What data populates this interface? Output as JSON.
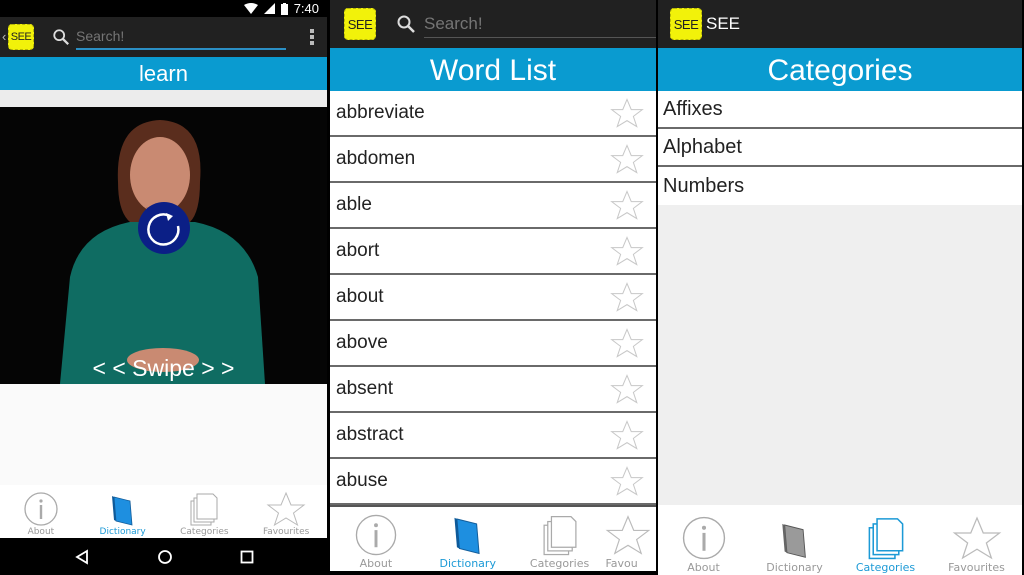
{
  "status_bar": {
    "time": "7:40"
  },
  "panel_learn": {
    "app_logo_text": "SEE",
    "search_placeholder": "Search!",
    "title": "learn",
    "swipe_hint": "< < Swipe > >",
    "tabs": [
      {
        "label": "About",
        "icon": "info-icon",
        "active": false
      },
      {
        "label": "Dictionary",
        "icon": "book-icon",
        "active": true
      },
      {
        "label": "Categories",
        "icon": "pages-icon",
        "active": false
      },
      {
        "label": "Favourites",
        "icon": "star-icon",
        "active": false
      }
    ]
  },
  "panel_wordlist": {
    "app_logo_text": "SEE",
    "search_placeholder": "Search!",
    "title": "Word List",
    "words": [
      "abbreviate",
      "abdomen",
      "able",
      "abort",
      "about",
      "above",
      "absent",
      "abstract",
      "abuse"
    ],
    "tabs": [
      {
        "label": "About",
        "icon": "info-icon",
        "active": false
      },
      {
        "label": "Dictionary",
        "icon": "book-icon",
        "active": true
      },
      {
        "label": "Categories",
        "icon": "pages-icon",
        "active": false
      },
      {
        "label": "Favou",
        "icon": "star-icon",
        "active": false
      }
    ]
  },
  "panel_categories": {
    "app_logo_text": "SEE",
    "app_name": "SEE",
    "title": "Categories",
    "categories": [
      "Affixes",
      "Alphabet",
      "Numbers"
    ],
    "tabs": [
      {
        "label": "About",
        "icon": "info-icon",
        "active": false
      },
      {
        "label": "Dictionary",
        "icon": "book-icon",
        "active": false
      },
      {
        "label": "Categories",
        "icon": "pages-icon",
        "active": true
      },
      {
        "label": "Favourites",
        "icon": "star-icon",
        "active": false
      }
    ]
  },
  "colors": {
    "accent_blue": "#0a9bd0",
    "active_tab": "#1c9ad6",
    "action_bar": "#212121",
    "logo_yellow": "#f2f20a",
    "replay_button": "#0b1f86"
  }
}
